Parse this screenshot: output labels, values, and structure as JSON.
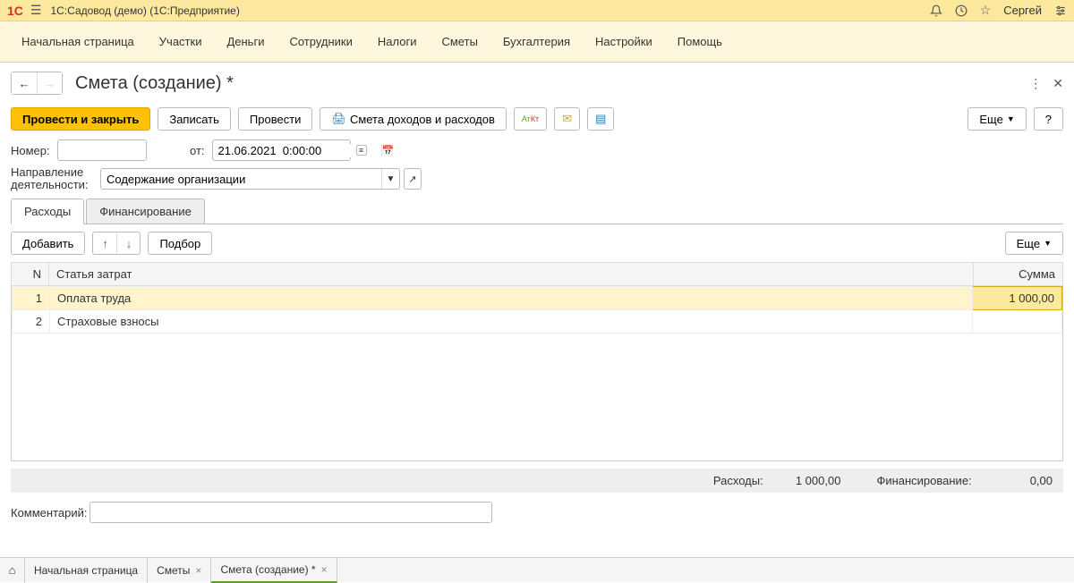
{
  "header": {
    "logo": "1C",
    "title": "1С:Садовод (демо)  (1С:Предприятие)",
    "user": "Сергей"
  },
  "menu": [
    "Начальная страница",
    "Участки",
    "Деньги",
    "Сотрудники",
    "Налоги",
    "Сметы",
    "Бухгалтерия",
    "Настройки",
    "Помощь"
  ],
  "page": {
    "title": "Смета (создание) *"
  },
  "toolbar": {
    "post_close": "Провести и закрыть",
    "save": "Записать",
    "post": "Провести",
    "print_doc": "Смета доходов и расходов",
    "more": "Еще",
    "help": "?"
  },
  "fields": {
    "number_label": "Номер:",
    "number_value": "",
    "from_label": "от:",
    "date_value": "21.06.2021  0:00:00",
    "direction_label": "Направление деятельности:",
    "direction_value": "Содержание организации"
  },
  "tabs": {
    "expenses": "Расходы",
    "financing": "Финансирование"
  },
  "table_toolbar": {
    "add": "Добавить",
    "select": "Подбор",
    "more": "Еще"
  },
  "columns": {
    "n": "N",
    "item": "Статья затрат",
    "sum": "Сумма"
  },
  "rows": [
    {
      "n": "1",
      "item": "Оплата труда",
      "sum": "1 000,00"
    },
    {
      "n": "2",
      "item": "Страховые взносы",
      "sum": ""
    }
  ],
  "totals": {
    "expenses_label": "Расходы:",
    "expenses_value": "1 000,00",
    "financing_label": "Финансирование:",
    "financing_value": "0,00"
  },
  "comment": {
    "label": "Комментарий:",
    "value": ""
  },
  "bottom_tabs": {
    "home": "Начальная страница",
    "t1": "Сметы",
    "t2": "Смета (создание) *"
  }
}
